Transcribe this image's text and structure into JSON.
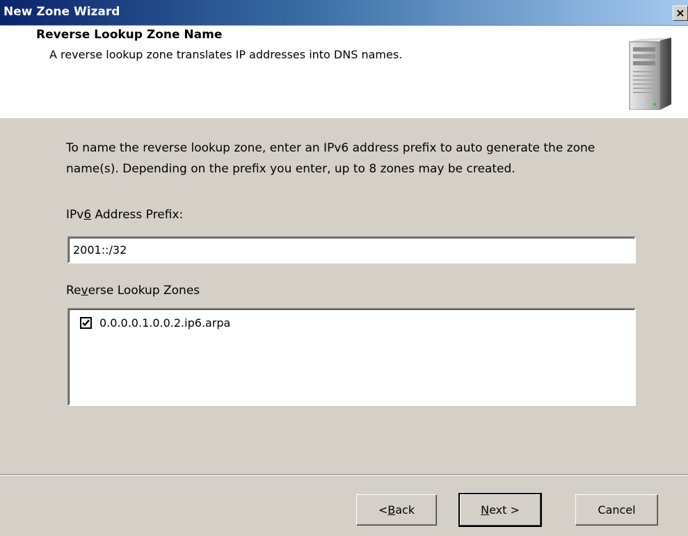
{
  "window": {
    "title": "New Zone Wizard",
    "close_glyph": "×"
  },
  "header": {
    "title": "Reverse Lookup Zone Name",
    "subtitle": "A reverse lookup zone translates IP addresses into DNS names.",
    "icon": "server-icon"
  },
  "body": {
    "instructions": "To name the reverse lookup zone, enter an IPv6 address prefix to auto generate the zone name(s).  Depending on the prefix you enter, up to 8 zones may be created.",
    "prefix_label_pre": "IPv",
    "prefix_label_accel": "6",
    "prefix_label_post": " Address Prefix:",
    "prefix_value": "2001::/32",
    "zones_label_pre": "Re",
    "zones_label_accel": "v",
    "zones_label_post": "erse Lookup Zones",
    "zones": [
      {
        "label": "0.0.0.0.1.0.0.2.ip6.arpa",
        "checked": true
      }
    ]
  },
  "buttons": {
    "back_pre": "< ",
    "back_accel": "B",
    "back_post": "ack",
    "next_accel": "N",
    "next_post": "ext >",
    "cancel": "Cancel"
  }
}
